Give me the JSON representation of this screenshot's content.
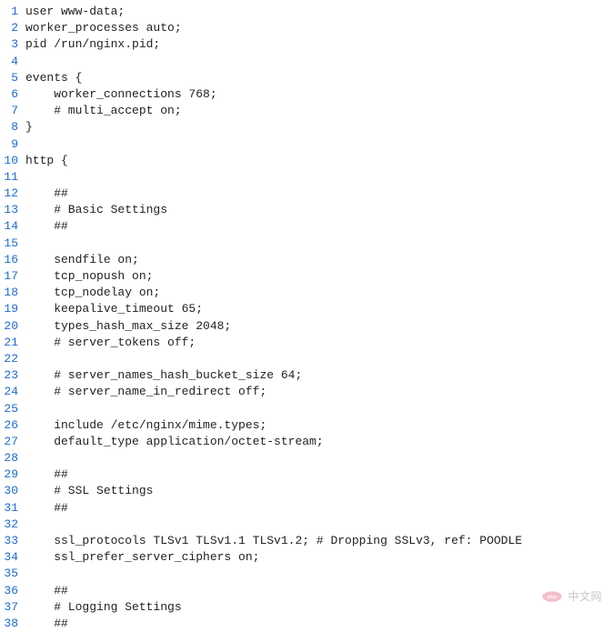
{
  "lines": [
    {
      "n": 1,
      "t": "user www-data;"
    },
    {
      "n": 2,
      "t": "worker_processes auto;"
    },
    {
      "n": 3,
      "t": "pid /run/nginx.pid;"
    },
    {
      "n": 4,
      "t": ""
    },
    {
      "n": 5,
      "t": "events {"
    },
    {
      "n": 6,
      "t": "    worker_connections 768;"
    },
    {
      "n": 7,
      "t": "    # multi_accept on;"
    },
    {
      "n": 8,
      "t": "}"
    },
    {
      "n": 9,
      "t": ""
    },
    {
      "n": 10,
      "t": "http {"
    },
    {
      "n": 11,
      "t": ""
    },
    {
      "n": 12,
      "t": "    ##"
    },
    {
      "n": 13,
      "t": "    # Basic Settings"
    },
    {
      "n": 14,
      "t": "    ##"
    },
    {
      "n": 15,
      "t": ""
    },
    {
      "n": 16,
      "t": "    sendfile on;"
    },
    {
      "n": 17,
      "t": "    tcp_nopush on;"
    },
    {
      "n": 18,
      "t": "    tcp_nodelay on;"
    },
    {
      "n": 19,
      "t": "    keepalive_timeout 65;"
    },
    {
      "n": 20,
      "t": "    types_hash_max_size 2048;"
    },
    {
      "n": 21,
      "t": "    # server_tokens off;"
    },
    {
      "n": 22,
      "t": ""
    },
    {
      "n": 23,
      "t": "    # server_names_hash_bucket_size 64;"
    },
    {
      "n": 24,
      "t": "    # server_name_in_redirect off;"
    },
    {
      "n": 25,
      "t": ""
    },
    {
      "n": 26,
      "t": "    include /etc/nginx/mime.types;"
    },
    {
      "n": 27,
      "t": "    default_type application/octet-stream;"
    },
    {
      "n": 28,
      "t": ""
    },
    {
      "n": 29,
      "t": "    ##"
    },
    {
      "n": 30,
      "t": "    # SSL Settings"
    },
    {
      "n": 31,
      "t": "    ##"
    },
    {
      "n": 32,
      "t": ""
    },
    {
      "n": 33,
      "t": "    ssl_protocols TLSv1 TLSv1.1 TLSv1.2; # Dropping SSLv3, ref: POODLE"
    },
    {
      "n": 34,
      "t": "    ssl_prefer_server_ciphers on;"
    },
    {
      "n": 35,
      "t": ""
    },
    {
      "n": 36,
      "t": "    ##"
    },
    {
      "n": 37,
      "t": "    # Logging Settings"
    },
    {
      "n": 38,
      "t": "    ##"
    }
  ],
  "watermark": {
    "text": "中文网",
    "prefix": "php"
  }
}
